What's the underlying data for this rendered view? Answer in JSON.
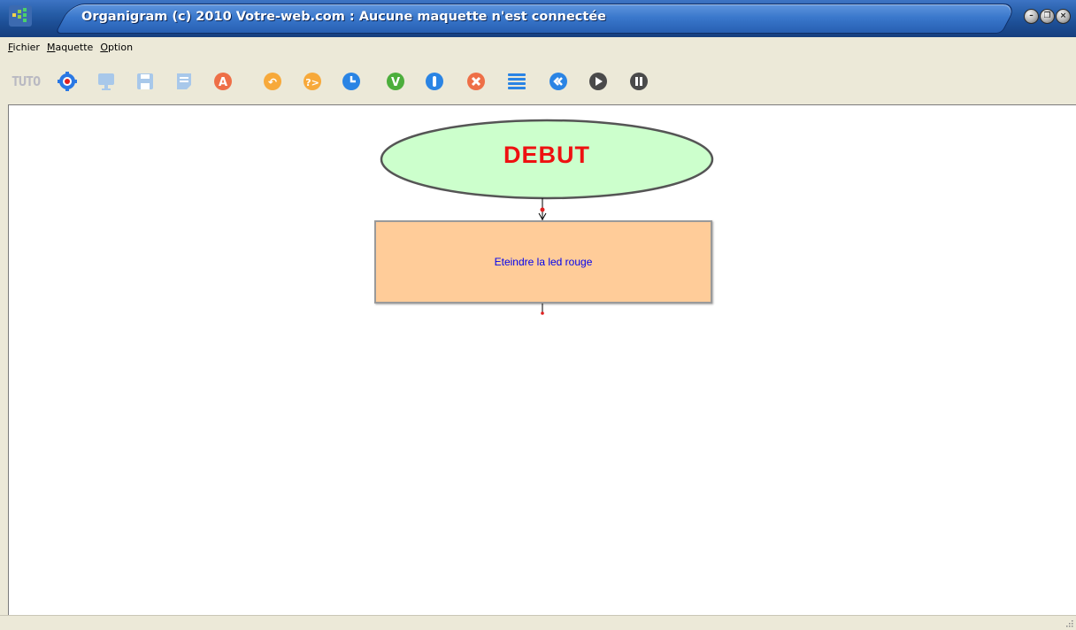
{
  "window": {
    "title": "Organigram (c) 2010 Votre-web.com :  Aucune maquette n'est connectée",
    "controls": [
      "minimize-icon",
      "restore-icon",
      "close-icon"
    ]
  },
  "menu": {
    "items": [
      {
        "label": "Fichier"
      },
      {
        "label": "Maquette"
      },
      {
        "label": "Option"
      }
    ]
  },
  "toolbar": {
    "tuto_label": "TUTO",
    "buttons": [
      {
        "icon": "settings-gear-icon",
        "color": "#2a78e4"
      },
      {
        "icon": "monitor-icon",
        "color": "#a8c8ea"
      },
      {
        "icon": "save-disk-icon",
        "color": "#a8c8ea"
      },
      {
        "icon": "document-icon",
        "color": "#a8c8ea"
      },
      {
        "icon": "badge-a-icon",
        "color": "#ee6f47"
      },
      {
        "icon": "badge-back-icon",
        "color": "#f7a93a"
      },
      {
        "icon": "badge-question-icon",
        "color": "#f7a93a"
      },
      {
        "icon": "clock-icon",
        "color": "#2a84e4"
      },
      {
        "icon": "badge-v-icon",
        "color": "#4cae3c"
      },
      {
        "icon": "info-icon",
        "color": "#2a84e4"
      },
      {
        "icon": "close-badge-icon",
        "color": "#ee6f47"
      },
      {
        "icon": "list-icon",
        "color": "#2a84e4"
      },
      {
        "icon": "rewind-icon",
        "color": "#2a84e4"
      },
      {
        "icon": "play-icon",
        "color": "#4a4a4a"
      },
      {
        "icon": "pause-icon",
        "color": "#4a4a4a"
      }
    ]
  },
  "flowchart": {
    "start_label": "DEBUT",
    "start_fill": "#ccffcc",
    "action_label": "Eteindre la led rouge",
    "action_fill": "#ffcc99",
    "label_color": "#0000ee",
    "start_color": "#ee1111"
  }
}
